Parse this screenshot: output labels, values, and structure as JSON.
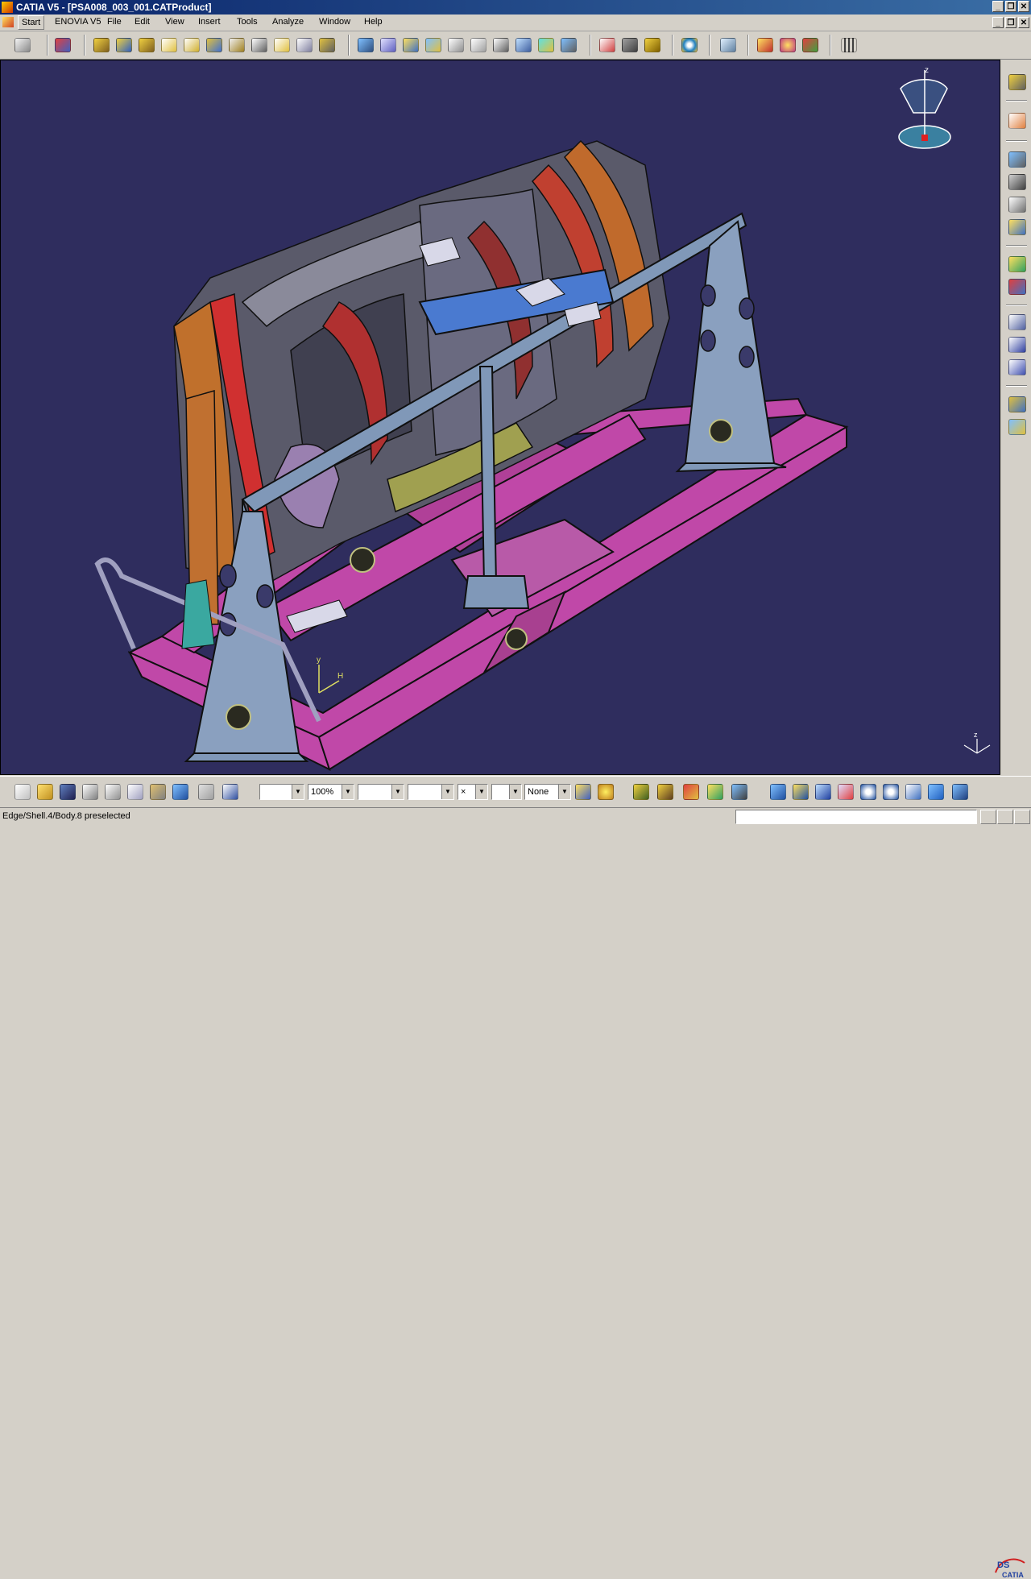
{
  "window": {
    "title": "CATIA V5 - [PSA008_003_001.CATProduct]",
    "minimize_glyph": "_",
    "restore_glyph": "❐",
    "close_glyph": "✕"
  },
  "menu": {
    "items": [
      {
        "label": "Start"
      },
      {
        "label": "ENOVIA V5"
      },
      {
        "label": "File"
      },
      {
        "label": "Edit"
      },
      {
        "label": "View"
      },
      {
        "label": "Insert"
      },
      {
        "label": "Tools"
      },
      {
        "label": "Analyze"
      },
      {
        "label": "Window"
      },
      {
        "label": "Help"
      }
    ]
  },
  "bottom_toolbar": {
    "color_combo": "",
    "transparency_combo": "100%",
    "linetype_combo": "",
    "thickness_combo": "",
    "point_combo": "×",
    "layer_icon_combo": "",
    "layer_combo": "None",
    "combo_arrow": "▼"
  },
  "viewport": {
    "background": "#2f2d5e",
    "compass_axis_label": "z",
    "axis_labels": {
      "y": "y",
      "h": "H",
      "z": "z"
    }
  },
  "brand": {
    "logo_text": "CATIA",
    "logo_mark": "DS"
  },
  "status": {
    "text": "Edge/Shell.4/Body.8 preselected"
  },
  "icons": {
    "top_toolbar": [
      "select-icon",
      "catalog-icon",
      "gear-assembly-icon",
      "gear-assembly-2-icon",
      "gear-assembly-3-icon",
      "insert-component-icon",
      "replace-component-icon",
      "fast-multi-instantiation-icon",
      "reorder-icon",
      "numbering-icon",
      "bill-of-material-icon",
      "reconcile-icon",
      "constraint-icon",
      "snap-icon",
      "manipulate-icon",
      "explode-icon",
      "clash-icon",
      "measure-icon",
      "sectioning-icon",
      "coincidence-icon",
      "contact-icon",
      "offset-icon",
      "angle-icon",
      "fix-icon",
      "fix-together-icon",
      "update-icon",
      "measure-between-icon",
      "measure-item-icon",
      "measure-inertia-icon",
      "spiral-icon",
      "scene-icon",
      "enhanced-scene-icon",
      "publication-icon",
      "material-icon",
      "grid-icon"
    ],
    "right_toolbar": [
      "gear-icon",
      "arrow-select-icon",
      "product-icon",
      "component-icon",
      "existing-component-icon",
      "positioning-icon",
      "bom-icon",
      "render-icon",
      "annotation-icon",
      "abc-text-icon",
      "flag-note-icon",
      "cube-icon",
      "cube-2-icon"
    ],
    "bottom_toolbar": [
      "new-file-icon",
      "open-folder-icon",
      "save-icon",
      "print-icon",
      "cut-icon",
      "copy-icon",
      "paste-icon",
      "undo-icon",
      "redo-icon",
      "whats-this-icon",
      "paint-brush-icon",
      "bulb-icon",
      "gear-update-icon",
      "gear-update-2-icon",
      "assembly-design-icon",
      "product-tree-icon",
      "manipulator-icon",
      "fly-icon",
      "fit-all-icon",
      "pan-icon",
      "rotate-icon",
      "zoom-in-icon",
      "zoom-out-icon",
      "normal-view-icon",
      "iso-view-icon",
      "render-style-icon"
    ]
  }
}
